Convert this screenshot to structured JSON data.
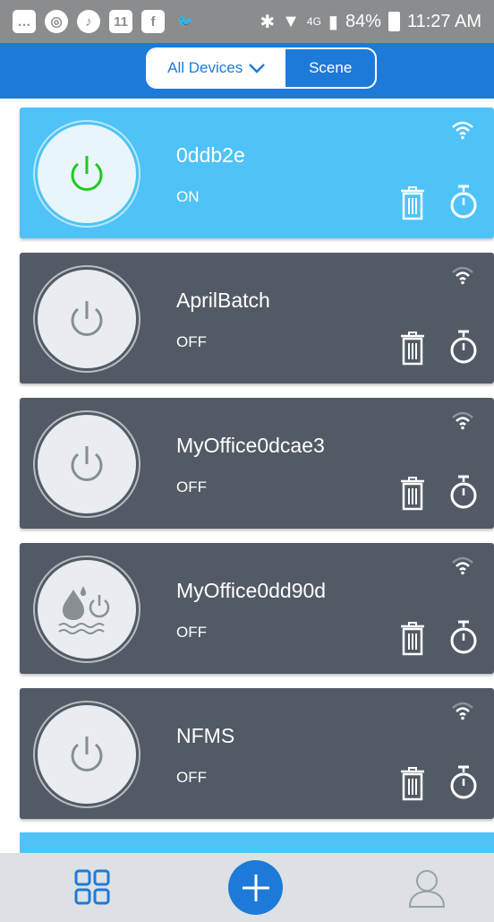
{
  "status_bar": {
    "left_icons": [
      "message-icon",
      "chrome-icon",
      "music-icon",
      "news-11-icon",
      "facebook-icon",
      "twitter-icon"
    ],
    "news_icon_text": "11",
    "network": "4G",
    "battery": "84%",
    "time": "11:27 AM"
  },
  "header": {
    "tabs": [
      {
        "label": "All Devices",
        "active": true
      },
      {
        "label": "Scene",
        "active": false
      }
    ]
  },
  "devices": [
    {
      "name": "0ddb2e",
      "state": "ON",
      "icon": "power-icon",
      "color": "#4fc3f7"
    },
    {
      "name": "AprilBatch",
      "state": "OFF",
      "icon": "power-icon",
      "color": "#525a65"
    },
    {
      "name": "MyOffice0dcae3",
      "state": "OFF",
      "icon": "power-icon",
      "color": "#525a65"
    },
    {
      "name": "MyOffice0dd90d",
      "state": "OFF",
      "icon": "water-heater-power-icon",
      "color": "#525a65"
    },
    {
      "name": "NFMS",
      "state": "OFF",
      "icon": "power-icon",
      "color": "#525a65"
    }
  ],
  "bottom_nav": {
    "items": [
      "devices-grid-icon",
      "add-icon",
      "user-icon"
    ]
  },
  "colors": {
    "accent": "#1e7ad8",
    "on_card": "#4fc3f7",
    "off_card": "#525a65",
    "power_on": "#22c722",
    "power_off": "#888d93"
  }
}
